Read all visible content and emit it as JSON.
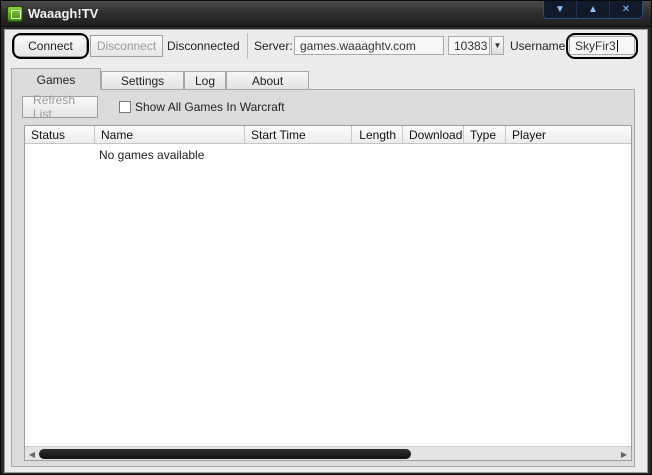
{
  "window": {
    "title": "Waaagh!TV",
    "controls": [
      "▼",
      "▲",
      "✕"
    ]
  },
  "toolbar": {
    "connect_label": "Connect",
    "disconnect_label": "Disconnect",
    "status": "Disconnected",
    "server_label": "Server:",
    "server_value": "games.waaaghtv.com",
    "port_value": "10383",
    "username_label": "Username:",
    "username_value": "SkyFir3"
  },
  "tabs": [
    {
      "label": "Games",
      "active": true
    },
    {
      "label": "Settings",
      "active": false
    },
    {
      "label": "Log",
      "active": false
    },
    {
      "label": "About",
      "active": false
    }
  ],
  "games_tab": {
    "refresh_label": "Refresh List",
    "show_all_label": "Show All Games In Warcraft",
    "show_all_checked": false,
    "columns": [
      "Status",
      "Name",
      "Start Time",
      "Length",
      "Download",
      "Type",
      "Player"
    ],
    "empty_message": "No games available"
  }
}
